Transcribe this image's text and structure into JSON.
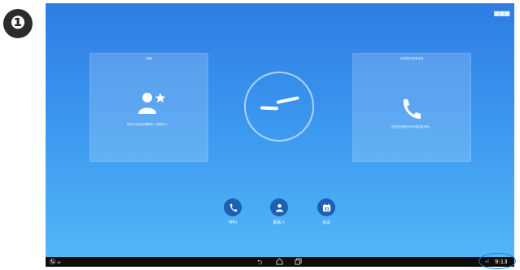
{
  "step_number": "❶",
  "screen": {
    "top_menu_icon": "apps-grid-icon",
    "favorites_panel": {
      "title": "收藏",
      "icon": "person-star-icon",
      "text": "您还未添加收藏联系人或联系人。"
    },
    "recent_calls_panel": {
      "title": "未接呼叫或未应答",
      "icon": "phone-icon",
      "text": "您还没有最近呼叫或未接来电。"
    },
    "clock": {
      "time": "9:13"
    },
    "actions": [
      {
        "label": "呼叫",
        "icon": "phone-icon"
      },
      {
        "label": "联系人",
        "icon": "person-icon"
      },
      {
        "label": "会议",
        "icon": "calendar-icon",
        "badge": "31"
      }
    ]
  },
  "status_bar": {
    "signal": "ııııııı",
    "back_glyph": "⮌",
    "volume_glyph": "◂)",
    "time": "9:13"
  },
  "colors": {
    "screen_top": "#2f7de3",
    "screen_bottom": "#52b6f7",
    "action_button": "#1d5fb0",
    "highlight": "#1a7fd9"
  }
}
